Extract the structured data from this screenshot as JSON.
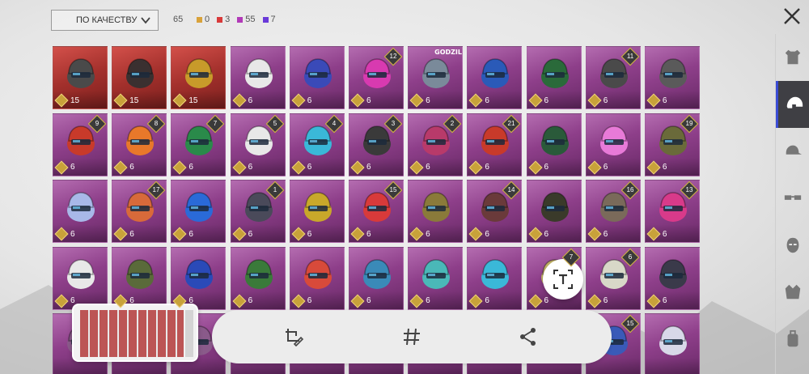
{
  "sort": {
    "selected": "ПО КАЧЕСТВУ"
  },
  "summary": {
    "total": "65",
    "counts": [
      {
        "value": "0",
        "color": "#d9a23a"
      },
      {
        "value": "3",
        "color": "#d93a3a"
      },
      {
        "value": "55",
        "color": "#b13ab8"
      },
      {
        "value": "7",
        "color": "#6a3ad9"
      }
    ]
  },
  "rail": [
    {
      "icon": "outfit-icon",
      "active": false
    },
    {
      "icon": "helmet-icon",
      "active": true
    },
    {
      "icon": "cap-icon",
      "active": false
    },
    {
      "icon": "glasses-icon",
      "active": false
    },
    {
      "icon": "mask-icon",
      "active": false
    },
    {
      "icon": "jacket-icon",
      "active": false
    },
    {
      "icon": "backpack-icon",
      "active": false
    }
  ],
  "items": [
    {
      "value": "15",
      "rarity": "red",
      "badge": "",
      "color": "#4a4a4a"
    },
    {
      "value": "15",
      "rarity": "red",
      "badge": "",
      "color": "#3a3030"
    },
    {
      "value": "15",
      "rarity": "red",
      "badge": "",
      "color": "#c89a2a"
    },
    {
      "value": "6",
      "rarity": "purple",
      "badge": "",
      "color": "#e8e8e8"
    },
    {
      "value": "6",
      "rarity": "purple",
      "badge": "",
      "color": "#3a4ab8"
    },
    {
      "value": "6",
      "rarity": "purple",
      "badge": "12",
      "color": "#d83ab0"
    },
    {
      "value": "6",
      "rarity": "purple",
      "badge": "",
      "color": "#7a8a9a",
      "brand": "GODZILLA"
    },
    {
      "value": "6",
      "rarity": "purple",
      "badge": "",
      "color": "#2a5ab8"
    },
    {
      "value": "6",
      "rarity": "purple",
      "badge": "",
      "color": "#2a6a3a"
    },
    {
      "value": "6",
      "rarity": "purple",
      "badge": "11",
      "color": "#4a4a4a"
    },
    {
      "value": "6",
      "rarity": "purple",
      "badge": "",
      "color": "#5a5a5a"
    },
    {
      "value": "6",
      "rarity": "purple",
      "badge": "9",
      "color": "#c83a2a"
    },
    {
      "value": "6",
      "rarity": "purple",
      "badge": "8",
      "color": "#e8782a"
    },
    {
      "value": "6",
      "rarity": "purple",
      "badge": "7",
      "color": "#2a8a4a"
    },
    {
      "value": "6",
      "rarity": "purple",
      "badge": "5",
      "color": "#e8e8e8"
    },
    {
      "value": "6",
      "rarity": "purple",
      "badge": "4",
      "color": "#3ab8d8"
    },
    {
      "value": "6",
      "rarity": "purple",
      "badge": "3",
      "color": "#3a3a3a"
    },
    {
      "value": "6",
      "rarity": "purple",
      "badge": "2",
      "color": "#b83a6a"
    },
    {
      "value": "6",
      "rarity": "purple",
      "badge": "21",
      "color": "#c83a2a"
    },
    {
      "value": "6",
      "rarity": "purple",
      "badge": "",
      "color": "#2a5a3a"
    },
    {
      "value": "6",
      "rarity": "purple",
      "badge": "",
      "color": "#e87ad8"
    },
    {
      "value": "6",
      "rarity": "purple",
      "badge": "19",
      "color": "#6a6a3a"
    },
    {
      "value": "6",
      "rarity": "purple",
      "badge": "",
      "color": "#a8b8e8"
    },
    {
      "value": "6",
      "rarity": "purple",
      "badge": "17",
      "color": "#d86a3a"
    },
    {
      "value": "6",
      "rarity": "purple",
      "badge": "",
      "color": "#2a6ad8"
    },
    {
      "value": "6",
      "rarity": "purple",
      "badge": "1",
      "color": "#4a4a5a"
    },
    {
      "value": "6",
      "rarity": "purple",
      "badge": "",
      "color": "#c8a82a"
    },
    {
      "value": "6",
      "rarity": "purple",
      "badge": "15",
      "color": "#d83a3a"
    },
    {
      "value": "6",
      "rarity": "purple",
      "badge": "",
      "color": "#8a7a3a"
    },
    {
      "value": "6",
      "rarity": "purple",
      "badge": "14",
      "color": "#6a3a3a"
    },
    {
      "value": "6",
      "rarity": "purple",
      "badge": "",
      "color": "#3a3a2a"
    },
    {
      "value": "6",
      "rarity": "purple",
      "badge": "16",
      "color": "#7a6a5a"
    },
    {
      "value": "6",
      "rarity": "purple",
      "badge": "13",
      "color": "#d83a8a"
    },
    {
      "value": "6",
      "rarity": "purple",
      "badge": "",
      "color": "#e8e8e8"
    },
    {
      "value": "6",
      "rarity": "purple",
      "badge": "",
      "color": "#5a6a3a"
    },
    {
      "value": "6",
      "rarity": "purple",
      "badge": "",
      "color": "#2a4ab8"
    },
    {
      "value": "6",
      "rarity": "purple",
      "badge": "",
      "color": "#3a7a3a"
    },
    {
      "value": "6",
      "rarity": "purple",
      "badge": "",
      "color": "#d84a3a"
    },
    {
      "value": "6",
      "rarity": "purple",
      "badge": "",
      "color": "#3a8ab8"
    },
    {
      "value": "6",
      "rarity": "purple",
      "badge": "",
      "color": "#4ab8b8"
    },
    {
      "value": "6",
      "rarity": "purple",
      "badge": "",
      "color": "#3ab8d8"
    },
    {
      "value": "6",
      "rarity": "purple",
      "badge": "7",
      "color": "#c8b86a"
    },
    {
      "value": "6",
      "rarity": "purple",
      "badge": "6",
      "color": "#d8d8c8"
    },
    {
      "value": "6",
      "rarity": "purple",
      "badge": "",
      "color": "#3a3a4a"
    },
    {
      "value": "",
      "rarity": "purple",
      "badge": "",
      "color": "#8a5a8a"
    },
    {
      "value": "",
      "rarity": "purple",
      "badge": "",
      "color": "#8a5a8a"
    },
    {
      "value": "",
      "rarity": "purple",
      "badge": "",
      "color": "#8a5a8a"
    },
    {
      "value": "",
      "rarity": "purple",
      "badge": "",
      "color": "#8a5a8a"
    },
    {
      "value": "",
      "rarity": "purple",
      "badge": "",
      "color": "#8a5a8a"
    },
    {
      "value": "",
      "rarity": "purple",
      "badge": "",
      "color": "#8a5a8a"
    },
    {
      "value": "",
      "rarity": "purple",
      "badge": "",
      "color": "#8a5a8a"
    },
    {
      "value": "",
      "rarity": "purple",
      "badge": "",
      "color": "#8a5a8a"
    },
    {
      "value": "",
      "rarity": "purple",
      "badge": "",
      "color": "#8a5a8a"
    },
    {
      "value": "",
      "rarity": "purple",
      "badge": "15",
      "color": "#3a5ab8"
    },
    {
      "value": "",
      "rarity": "purple",
      "badge": "",
      "color": "#d8d8e8"
    }
  ],
  "overlay": {
    "toolbar": [
      {
        "icon": "crop-edit-icon"
      },
      {
        "icon": "hashtag-icon"
      },
      {
        "icon": "share-icon"
      }
    ],
    "text_button_icon": "text-extract-icon"
  }
}
